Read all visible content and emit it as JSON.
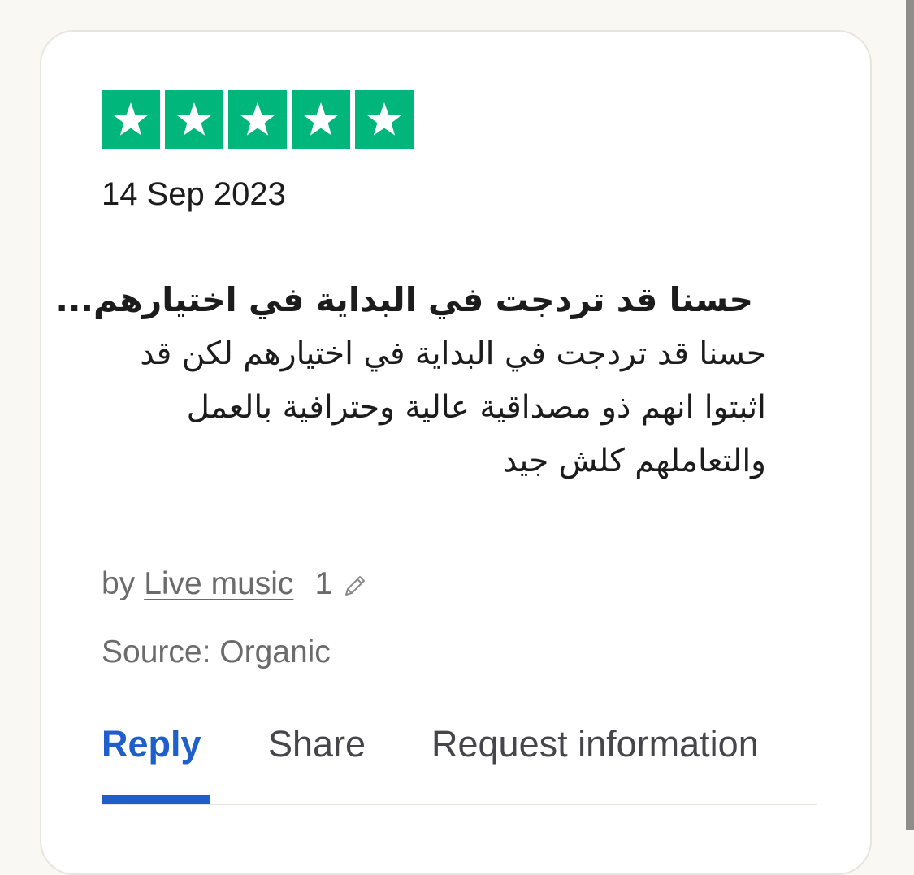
{
  "review": {
    "rating": 5,
    "rating_max": 5,
    "star_color": "#00b67a",
    "star_icon": "star-icon",
    "date": "14 Sep 2023",
    "title": "حسنا قد تردجت في البداية في اختيارهم...",
    "body": "حسنا قد تردجت في البداية في اختيارهم لكن قد\nاثبتوا انهم ذو مصداقية عالية وحترافية بالعمل\nوالتعاملهم كلش جيد",
    "by_label": "by",
    "author": "Live music",
    "review_count": "1",
    "edit_icon": "pencil-icon",
    "source": "Source: Organic"
  },
  "actions": {
    "reply": "Reply",
    "share": "Share",
    "request_info": "Request information",
    "active_color": "#1f5fcc"
  }
}
